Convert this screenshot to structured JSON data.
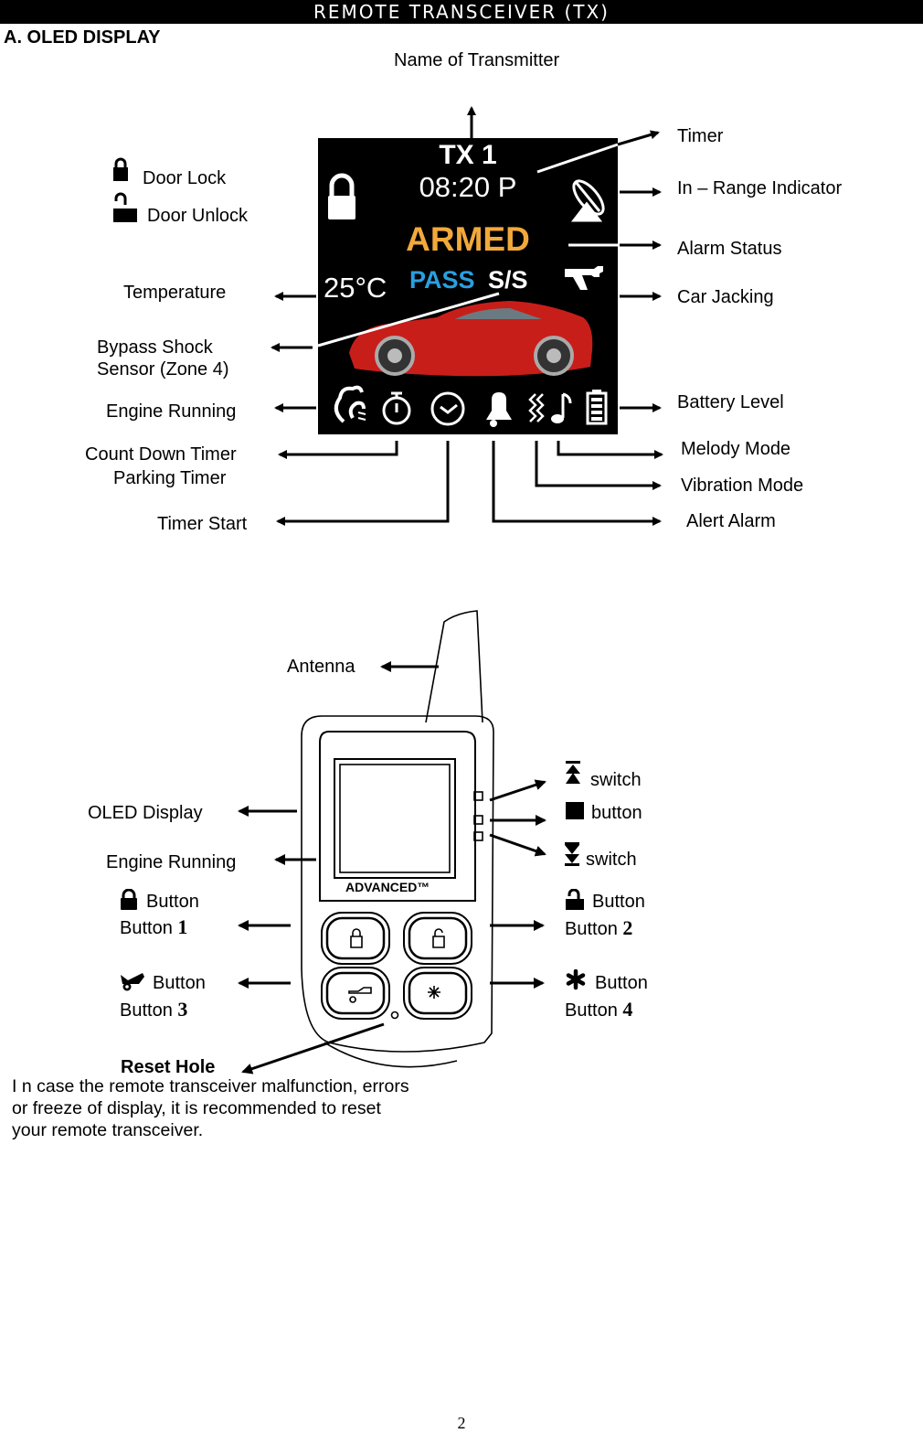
{
  "header": {
    "title": "REMOTE TRANSCEIVER (TX)"
  },
  "section": {
    "title": "A. OLED DISPLAY"
  },
  "oled_screen": {
    "transmitter_name": "TX 1",
    "time": "08:20 P",
    "alarm_status": "ARMED",
    "temperature": "25°C",
    "bypass_mode": "PASS",
    "bypass_zone": "S/S",
    "colors": {
      "armed": "#F2A93B",
      "pass": "#2A9FE0",
      "car": "#D0201C",
      "background": "#000000"
    }
  },
  "display_labels": {
    "name_of_transmitter": "Name of Transmitter",
    "door_lock": "Door Lock",
    "door_unlock": "Door Unlock",
    "temperature": "Temperature",
    "bypass_shock_line1": "Bypass Shock",
    "bypass_shock_line2": "Sensor (Zone 4)",
    "engine_running": "Engine Running",
    "count_down_timer": "Count Down Timer",
    "parking_timer": "Parking Timer",
    "timer_start": "Timer Start",
    "timer": "Timer",
    "in_range": "In – Range Indicator",
    "alarm_status": "Alarm Status",
    "car_jacking": "Car Jacking",
    "battery_level": "Battery Level",
    "melody_mode": "Melody Mode",
    "vibration_mode": "Vibration Mode",
    "alert_alarm": "Alert Alarm"
  },
  "device_labels": {
    "antenna": "Antenna",
    "oled_display": "OLED Display",
    "engine_running": "Engine Running",
    "button_word": "Button",
    "button_prefix": "Button",
    "button_1_num": "1",
    "button_2_num": "2",
    "button_3_num": "3",
    "button_4_num": "4",
    "switch_up": "switch",
    "middle_button": "button",
    "switch_down": "switch",
    "brand": "ADVANCED™",
    "reset_hole": "Reset Hole",
    "reset_note": "I n case the remote transceiver malfunction, errors or freeze of display, it is recommended to reset your remote transceiver."
  },
  "footer": {
    "page_number": "2"
  }
}
